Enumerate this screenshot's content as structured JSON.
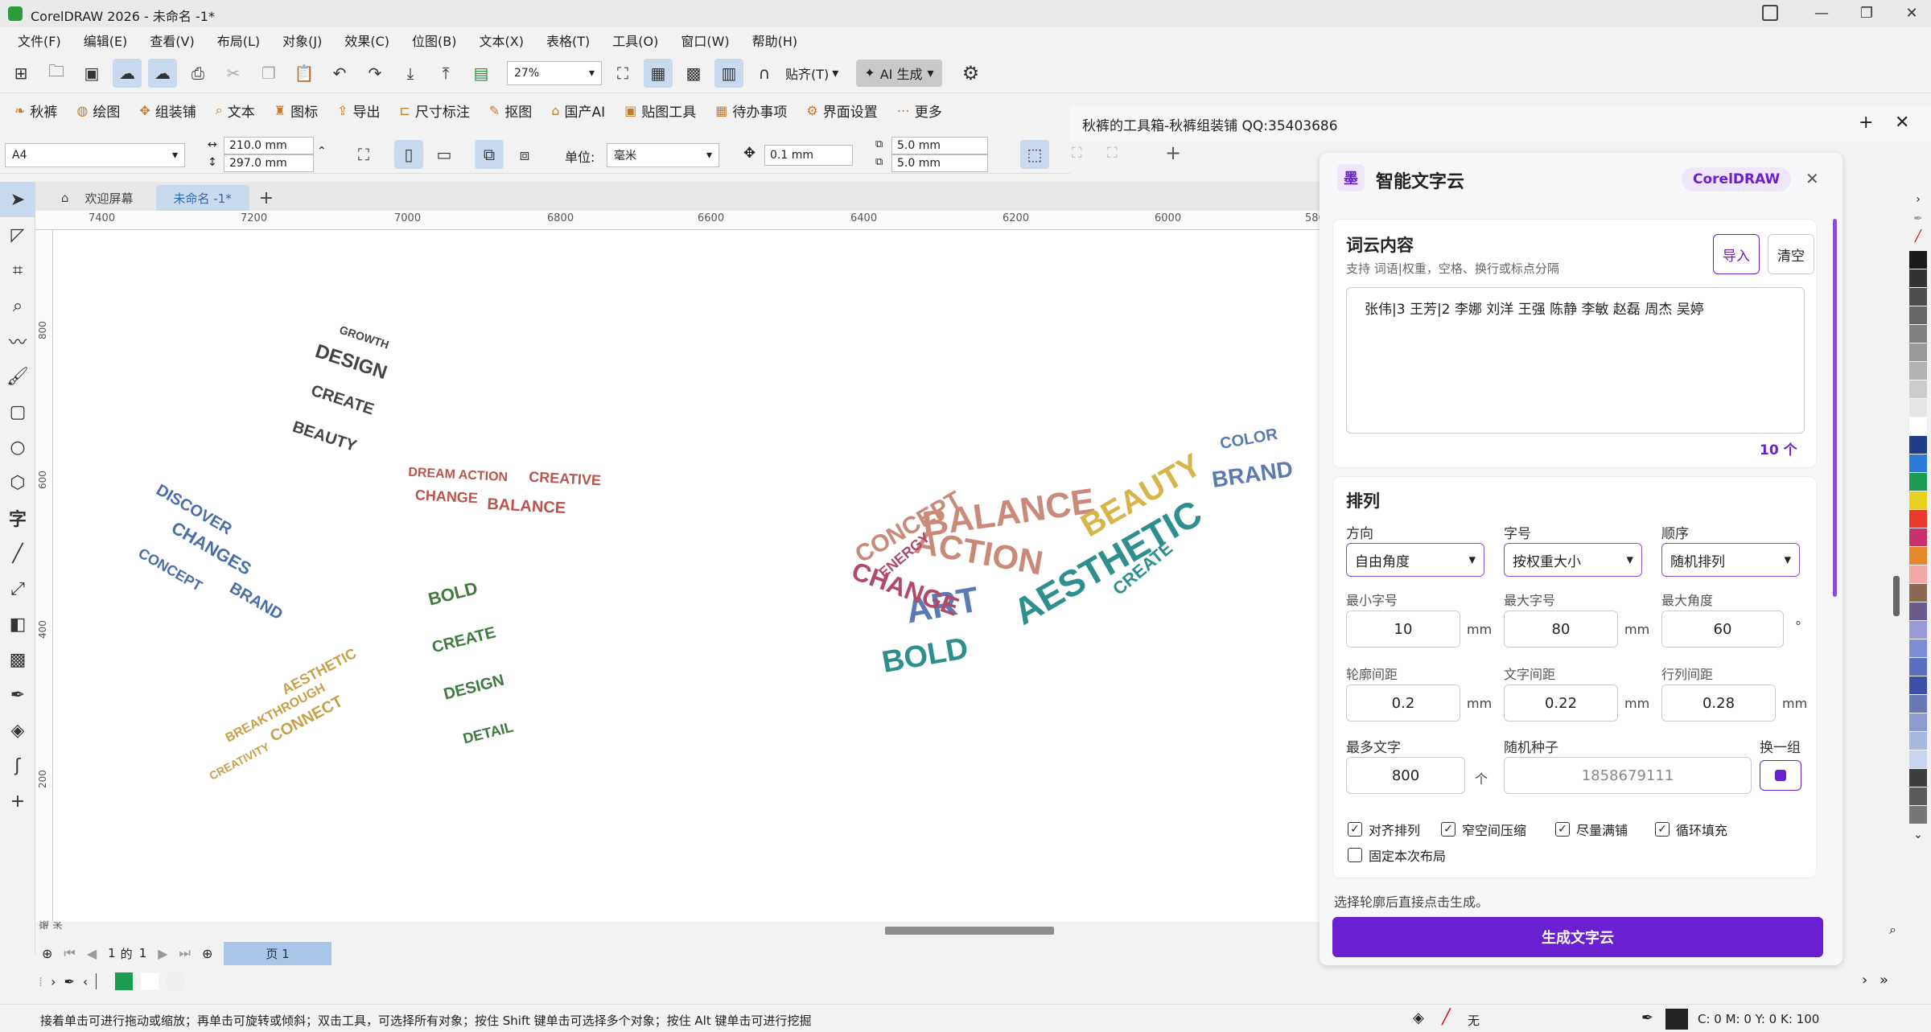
{
  "window": {
    "title": "CorelDRAW 2026 - 未命名 -1*",
    "minimize": "—",
    "maximize": "❐",
    "close": "✕"
  },
  "menu": [
    "文件(F)",
    "编辑(E)",
    "查看(V)",
    "布局(L)",
    "对象(J)",
    "效果(C)",
    "位图(B)",
    "文本(X)",
    "表格(T)",
    "工具(O)",
    "窗口(W)",
    "帮助(H)"
  ],
  "toolbar": {
    "zoom": "27%",
    "snap_label": "贴齐(T)",
    "ai_label": "AI 生成"
  },
  "plugins": [
    "秋裤",
    "绘图",
    "组装铺",
    "文本",
    "图标",
    "导出",
    "尺寸标注",
    "抠图",
    "国产AI",
    "贴图工具",
    "待办事项",
    "界面设置",
    "更多"
  ],
  "docker": {
    "title": "秋裤的工具箱-秋裤组装铺 QQ:35403686"
  },
  "propbar": {
    "paper": "A4",
    "width": "210.0 mm",
    "height": "297.0 mm",
    "unit_label": "单位:",
    "unit": "毫米",
    "nudge": "0.1 mm",
    "dup_x": "5.0 mm",
    "dup_y": "5.0 mm"
  },
  "tabs": {
    "home": "欢迎屏幕",
    "doc": "未命名 -1*"
  },
  "ruler": {
    "h": [
      "7400",
      "7200",
      "7000",
      "6800",
      "6600",
      "6400",
      "6200",
      "6000",
      "580"
    ],
    "v": [
      "800",
      "600",
      "400",
      "200"
    ],
    "unit": "毫米"
  },
  "pagebar": {
    "current": "1",
    "of": "的",
    "total": "1",
    "page": "页 1"
  },
  "status": {
    "hint": "接着单击可进行拖动或缩放；再单击可旋转或倾斜；双击工具，可选择所有对象；按住 Shift 键单击可选择多个对象；按住 Alt 键单击可进行挖掘",
    "fill": "无",
    "cmyk": "C: 0 M: 0 Y: 0 K: 100"
  },
  "panel": {
    "logo": "墨",
    "title": "智能文字云",
    "brand": "CorelDRAW",
    "content_title": "词云内容",
    "content_hint": "支持 词语|权重，空格、换行或标点分隔",
    "import": "导入",
    "clear": "清空",
    "text": "张伟|3 王芳|2 李娜 刘洋 王强 陈静 李敏 赵磊 周杰 吴婷",
    "count": "10 个",
    "layout_title": "排列",
    "direction_label": "方向",
    "direction": "自由角度",
    "fontsize_label": "字号",
    "fontsize": "按权重大小",
    "order_label": "顺序",
    "order": "随机排列",
    "min_font_label": "最小字号",
    "min_font": "10",
    "max_font_label": "最大字号",
    "max_font": "80",
    "max_angle_label": "最大角度",
    "max_angle": "60",
    "outline_gap_label": "轮廓间距",
    "outline_gap": "0.2",
    "text_gap_label": "文字间距",
    "text_gap": "0.22",
    "line_gap_label": "行列间距",
    "line_gap": "0.28",
    "max_words_label": "最多文字",
    "max_words": "800",
    "max_words_unit": "个",
    "seed_label": "随机种子",
    "seed": "1858679111",
    "shuffle": "换一组",
    "mm": "mm",
    "deg": "°",
    "checks": [
      {
        "label": "对齐排列",
        "checked": true
      },
      {
        "label": "窄空间压缩",
        "checked": true
      },
      {
        "label": "尽量满铺",
        "checked": true
      },
      {
        "label": "循环填充",
        "checked": true
      },
      {
        "label": "固定本次布局",
        "checked": false
      }
    ],
    "footer_hint": "选择轮廓后直接点击生成。",
    "generate": "生成文字云"
  },
  "colors": {
    "accent": "#6a1fd0",
    "palette": [
      "#1a1a1a",
      "#333333",
      "#4d4d4d",
      "#666666",
      "#808080",
      "#999999",
      "#b3b3b3",
      "#cccccc",
      "#e6e6e6",
      "#ffffff",
      "#1f3c88",
      "#2b7bd6",
      "#1a9d52",
      "#e9d21f",
      "#e8392b",
      "#c8306c",
      "#e6892a",
      "#f0a8a8",
      "#8a6a55",
      "#6b5a8c",
      "#9a9ad6",
      "#7b8ed6",
      "#5b6fc2",
      "#3e4fa6",
      "#6b78b8",
      "#8e9ad0",
      "#a9b8e0",
      "#c9d4ee",
      "#3d3d3d",
      "#5a5a5a",
      "#777777"
    ]
  },
  "canvas_words": [
    {
      "t": "BALANCE",
      "c": "#c98a7a"
    },
    {
      "t": "ACTION",
      "c": "#c98a7a"
    },
    {
      "t": "BEAUTY",
      "c": "#d6b64a"
    },
    {
      "t": "AESTHETIC",
      "c": "#2f8f8f"
    },
    {
      "t": "ART",
      "c": "#5b7bb0"
    },
    {
      "t": "CHANGE",
      "c": "#b04a6a"
    },
    {
      "t": "BOLD",
      "c": "#2f8f8f"
    },
    {
      "t": "CONCEPT",
      "c": "#c98a7a"
    },
    {
      "t": "BRAND",
      "c": "#5b7bb0"
    },
    {
      "t": "COLOR",
      "c": "#5b7bb0"
    },
    {
      "t": "CREATE",
      "c": "#2f8f8f"
    },
    {
      "t": "ENERGY",
      "c": "#b04a6a"
    },
    {
      "t": "DESIGN",
      "c": "#444"
    },
    {
      "t": "CREATE",
      "c": "#444"
    },
    {
      "t": "BEAUTY",
      "c": "#444"
    },
    {
      "t": "GROWTH",
      "c": "#444"
    },
    {
      "t": "DREAM ACTION",
      "c": "#b8564e"
    },
    {
      "t": "CREATIVE",
      "c": "#b8564e"
    },
    {
      "t": "CHANGE",
      "c": "#b8564e"
    },
    {
      "t": "BALANCE",
      "c": "#b8564e"
    },
    {
      "t": "DISCOVER",
      "c": "#4a6ea8"
    },
    {
      "t": "CHANGES",
      "c": "#4a6ea8"
    },
    {
      "t": "BRAND",
      "c": "#4a6ea8"
    },
    {
      "t": "CONCEPT",
      "c": "#4a6ea8"
    },
    {
      "t": "CREATIVITY",
      "c": "#c9a04a"
    },
    {
      "t": "CONNECT",
      "c": "#c9a04a"
    },
    {
      "t": "BREAKTHROUGH",
      "c": "#c9a04a"
    },
    {
      "t": "AESTHETIC",
      "c": "#c9a04a"
    },
    {
      "t": "BOLD",
      "c": "#3f7a3f"
    },
    {
      "t": "CREATE",
      "c": "#3f7a3f"
    },
    {
      "t": "DESIGN",
      "c": "#3f7a3f"
    },
    {
      "t": "DETAIL",
      "c": "#3f7a3f"
    }
  ]
}
